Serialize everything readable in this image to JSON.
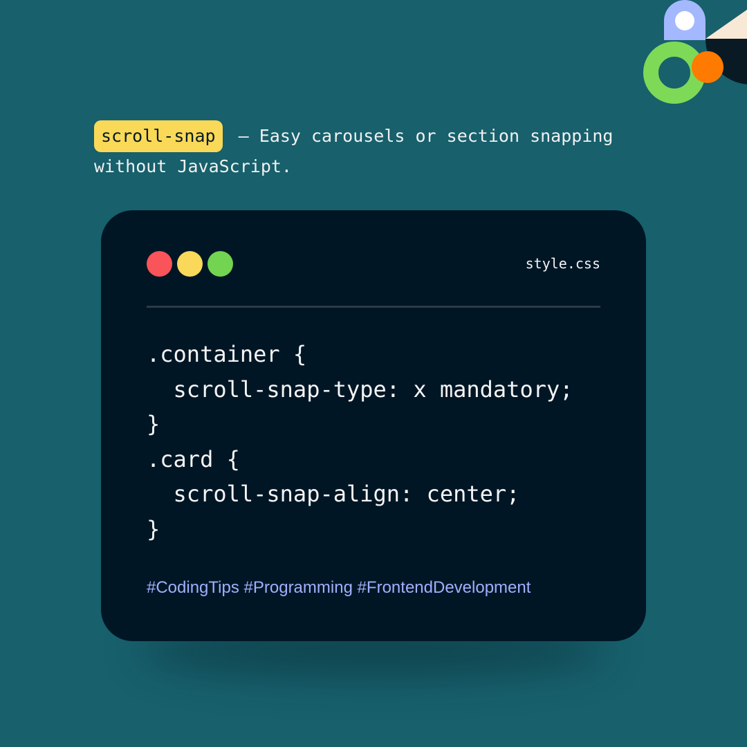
{
  "headline": {
    "keyword": "scroll-snap",
    "text": " – Easy carousels or section snapping without JavaScript."
  },
  "editor": {
    "filename": "style.css",
    "code_lines": [
      ".container {",
      "  scroll-snap-type: x mandatory;",
      "}",
      ".card {",
      "  scroll-snap-align: center;",
      "}"
    ],
    "hashtags": "#CodingTips #Programming #FrontendDevelopment"
  },
  "colors": {
    "background": "#17606c",
    "card": "#011625",
    "highlight": "#f9d957",
    "dot_red": "#f95459",
    "dot_yellow": "#fad85a",
    "dot_green": "#72d450",
    "hashtag": "#9fb0ff"
  },
  "icons": {
    "logo": "brand-logo-icon",
    "window_controls": [
      "close-dot-icon",
      "minimize-dot-icon",
      "maximize-dot-icon"
    ]
  }
}
